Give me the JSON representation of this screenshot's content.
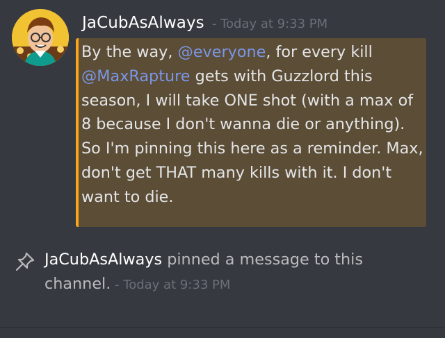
{
  "message": {
    "username": "JaCubAsAlways",
    "timestamp": "- Today at 9:33 PM",
    "segments": [
      {
        "text": "By the way, ",
        "mention": false
      },
      {
        "text": "@everyone",
        "mention": true
      },
      {
        "text": ", for every kill ",
        "mention": false
      },
      {
        "text": "@MaxRapture",
        "mention": true
      },
      {
        "text": " gets with Guzzlord this season, I will take ONE shot (with a max of 8 because I don't wanna die or anything). So I'm pinning this here as a reminder. Max, don't get THAT many kills with it. I don't want to die.",
        "mention": false
      }
    ]
  },
  "system": {
    "username": "JaCubAsAlways",
    "action": " pinned a message to this channel.",
    "timestamp": " - Today at 9:33 PM"
  },
  "colors": {
    "background": "#36393f",
    "highlight": "#5c4d36",
    "highlight_border": "#faa61a",
    "mention": "#7a96e6",
    "timestamp": "#6b6f77"
  },
  "icons": {
    "avatar": "avatar",
    "pin": "pin-icon"
  }
}
